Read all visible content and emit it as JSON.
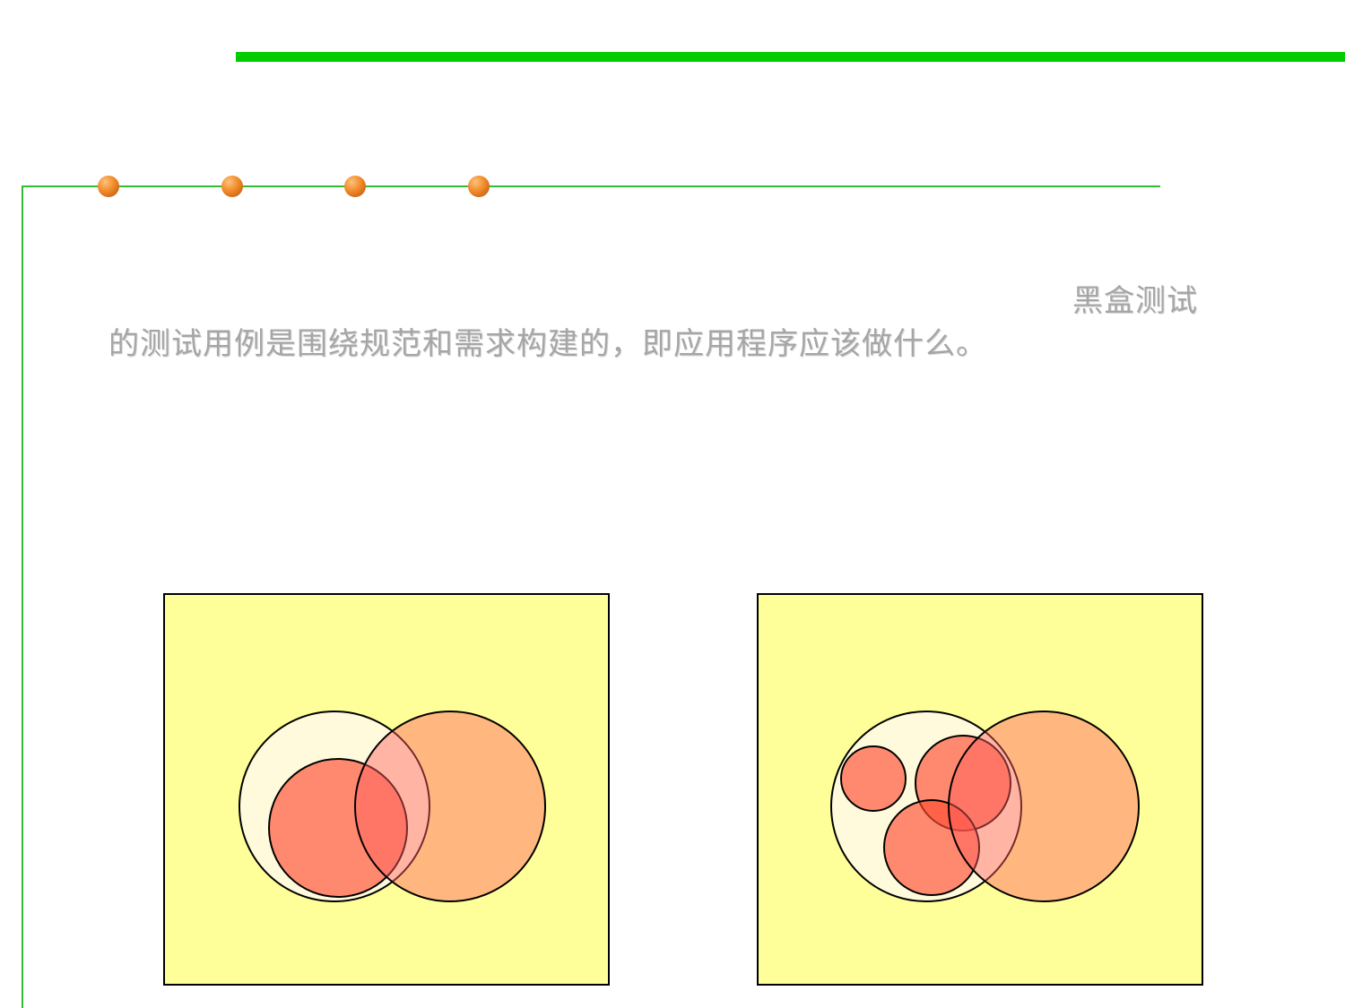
{
  "text": {
    "line1": "黑盒测试",
    "line2": "的测试用例是围绕规范和需求构建的，即应用程序应该做什么。"
  },
  "colors": {
    "top_bar": "#00cc00",
    "frame_line": "#33bb33",
    "dot": "#f08a2a",
    "diagram_bg": "#ffff99",
    "text": "#a6a6a6",
    "spec_circle": "#fffadc",
    "code_circle": "#ff8080",
    "test_circle": "#ff5a40"
  },
  "decorations": {
    "dots": [
      "dot",
      "dot",
      "dot",
      "dot"
    ]
  }
}
